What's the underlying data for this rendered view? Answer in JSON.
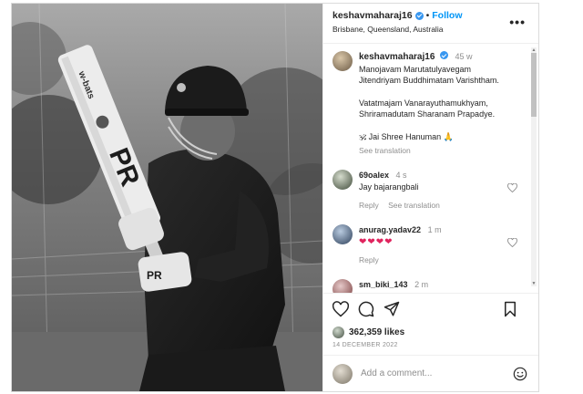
{
  "header": {
    "username": "keshavmaharaj16",
    "separator": "•",
    "follow_label": "Follow",
    "location": "Brisbane, Queensland, Australia",
    "more_icon": "more-horizontal-icon",
    "more_label": "•••"
  },
  "photo": {
    "bat_brand": "w-bats",
    "bat_text": "PR",
    "glove_text": "PR"
  },
  "caption": {
    "username": "keshavmaharaj16",
    "time": "45 w",
    "lines": [
      "Manojavam Marutatulyavegam",
      "Jitendriyam Buddhimatam Varishtham.",
      "Vatatmajam Vanarayuthamukhyam,",
      "Shriramadutam Sharanam Prapadye."
    ],
    "jai_line": "🕉 Jai Shree Hanuman 🙏",
    "see_translation": "See translation"
  },
  "comments": [
    {
      "username": "69oalex",
      "time": "4 s",
      "text": "Jay bajarangbali",
      "reply": "Reply",
      "see_translation": "See translation"
    },
    {
      "username": "anurag.yadav22",
      "time": "1 m",
      "text": "❤❤❤❤",
      "reply": "Reply"
    },
    {
      "username": "sm_biki_143",
      "time": "2 m"
    }
  ],
  "likes": {
    "count_text": "362,359 likes"
  },
  "date": "14 DECEMBER 2022",
  "add_comment": {
    "placeholder": "Add a comment..."
  },
  "colors": {
    "accent": "#0095f6",
    "verified": "#3897f0",
    "heart": "#e0245e",
    "muted": "#8e8e8e"
  }
}
